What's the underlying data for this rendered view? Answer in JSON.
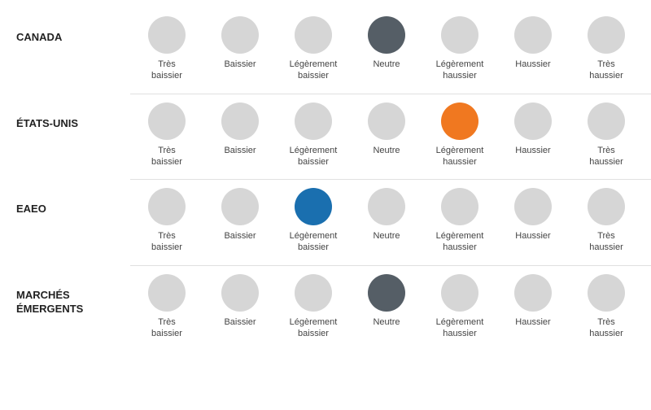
{
  "rows": [
    {
      "label": "CANADA",
      "multiline": false,
      "active_index": 3,
      "active_color": "dark-gray"
    },
    {
      "label": "ÉTATS-UNIS",
      "multiline": false,
      "active_index": 4,
      "active_color": "orange"
    },
    {
      "label": "EAEO",
      "multiline": false,
      "active_index": 2,
      "active_color": "blue"
    },
    {
      "label": "MARCHÉS\nÉMERGENTS",
      "multiline": true,
      "active_index": 3,
      "active_color": "dark-gray"
    }
  ],
  "columns": [
    {
      "line1": "Très",
      "line2": "baissier"
    },
    {
      "line1": "Baissier",
      "line2": ""
    },
    {
      "line1": "Légèrement",
      "line2": "baissier"
    },
    {
      "line1": "Neutre",
      "line2": ""
    },
    {
      "line1": "Légèrement",
      "line2": "haussier"
    },
    {
      "line1": "Haussier",
      "line2": ""
    },
    {
      "line1": "Très",
      "line2": "haussier"
    }
  ]
}
